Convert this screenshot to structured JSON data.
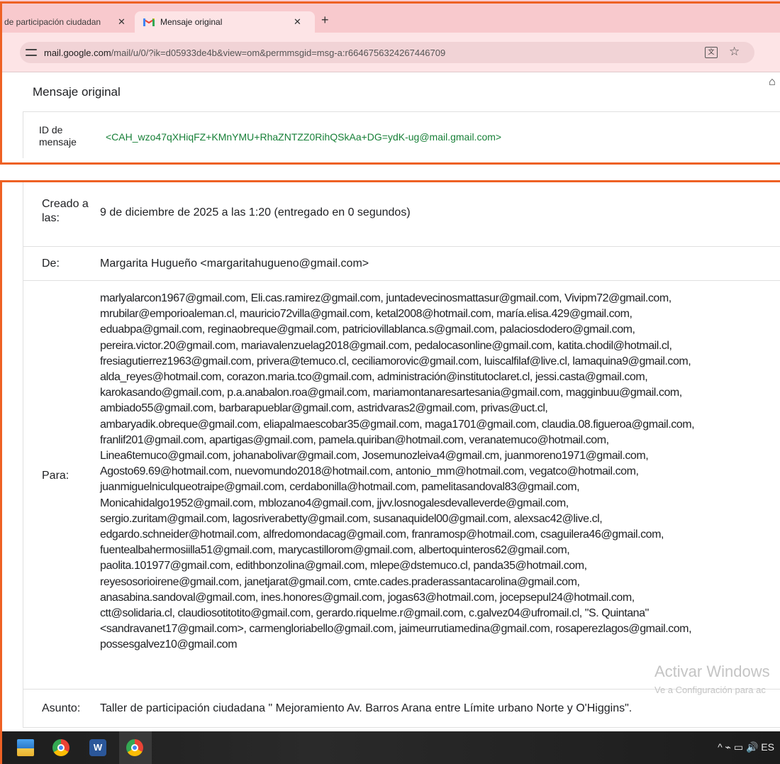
{
  "browser": {
    "tabs": [
      {
        "label": "de participación ciudadan",
        "active": false
      },
      {
        "label": "Mensaje original",
        "active": true
      }
    ],
    "new_tab_label": "+",
    "close_glyph": "✕",
    "url_host": "mail.google.com",
    "url_path": "/mail/u/0/?ik=d05933de4b&view=om&permmsgid=msg-a:r6646756324267446709",
    "translate_glyph": "文",
    "star_glyph": "☆",
    "extension_glyph": "⌂"
  },
  "page": {
    "title": "Mensaje original",
    "message_id_label": "ID de mensaje",
    "message_id_value": "<CAH_wzo47qXHiqFZ+KMnYMU+RhaZNTZZ0RihQSkAa+DG=ydK-ug@mail.gmail.com>"
  },
  "headers": {
    "created_label": "Creado a las:",
    "created_value": "9 de diciembre de 2025 a las 1:20 (entregado en 0 segundos)",
    "from_label": "De:",
    "from_value": "Margarita Hugueño <margaritahugueno@gmail.com>",
    "to_label": "Para:",
    "to_lines": [
      "marlyalarcon1967@gmail.com, Eli.cas.ramirez@gmail.com, juntadevecinosmattasur@gmail.com, Vivipm72@gmail.com,",
      "mrubilar@emporioaleman.cl, mauricio72villa@gmail.com, ketal2008@hotmail.com, maría.elisa.429@gmail.com,",
      "eduabpa@gmail.com, reginaobreque@gmail.com, patriciovillablanca.s@gmail.com, palaciosdodero@gmail.com,",
      "pereira.victor.20@gmail.com, mariavalenzuelag2018@gmail.com, pedalocasonline@gmail.com, katita.chodil@hotmail.cl,",
      "fresiagutierrez1963@gmail.com, privera@temuco.cl, ceciliamorovic@gmail.com, luiscalfilaf@live.cl, lamaquina9@gmail.com,",
      "alda_reyes@hotmail.com, corazon.maria.tco@gmail.com, administración@institutoclaret.cl, jessi.casta@gmail.com,",
      "karokasando@gmail.com, p.a.anabalon.roa@gmail.com, mariamontanaresartesania@gmail.com, magginbuu@gmail.com,",
      "ambiado55@gmail.com, barbarapueblar@gmail.com, astridvaras2@gmail.com, privas@uct.cl,",
      "ambaryadik.obreque@gmail.com, eliapalmaescobar35@gmail.com, maga1701@gmail.com, claudia.08.figueroa@gmail.com,",
      "franlif201@gmail.com, apartigas@gmail.com, pamela.quiriban@hotmail.com, veranatemuco@hotmail.com,",
      "Linea6temuco@gmail.com, johanabolivar@gmail.com, Josemunozleiva4@gmail.cm, juanmoreno1971@gmail.com,",
      "Agosto69.69@hotmail.com, nuevomundo2018@hotmail.com, antonio_mm@hotmail.com, vegatco@hotmail.com,",
      "juanmiguelniculqueotraipe@gmail.com, cerdabonilla@hotmail.com, pamelitasandoval83@gmail.com,",
      "Monicahidalgo1952@gmail.com, mblozano4@gmail.com, jjvv.losnogalesdevalleverde@gmail.com,",
      "sergio.zuritam@gmail.com, lagosriverabetty@gmail.com, susanaquidel00@gmail.com, alexsac42@live.cl,",
      "edgardo.schneider@hotmail.com, alfredomondacag@gmail.com, franramosp@hotmail.com, csaguilera46@gmail.com,",
      "fuentealbahermosiilla51@gmail.com, marycastillorom@gmail.com, albertoquinteros62@gmail.com,",
      "paolita.101977@gmail.com, edithbonzolina@gmail.com, mlepe@dstemuco.cl, panda35@hotmail.com,",
      "reyesosorioirene@gmail.com, janetjarat@gmail.com, cmte.cades.praderassantacarolina@gmail.com,",
      "anasabina.sandoval@gmail.com, ines.honores@gmail.com, jogas63@hotmail.com, jocepsepul24@hotmail.com,",
      "ctt@solidaria.cl, claudiosotitotito@gmail.com, gerardo.riquelme.r@gmail.com, c.galvez04@ufromail.cl, \"S. Quintana\"",
      "<sandravanet17@gmail.com>, carmengloriabello@gmail.com, jaimeurrutiamedina@gmail.com, rosaperezlagos@gmail.com,",
      "possesgalvez10@gmail.com"
    ],
    "subject_label": "Asunto:",
    "subject_value": "Taller de participación ciudadana \" Mejoramiento Av. Barros Arana entre Límite urbano Norte y O'Higgins\"."
  },
  "watermark": {
    "line1": "Activar Windows",
    "line2": "Ve a Configuración para ac"
  },
  "taskbar": {
    "word_letter": "W",
    "tray_text": "^  ⌁  ▭  🔊  ES"
  },
  "colors": {
    "highlight_frame": "#ee6124",
    "message_id": "#188038",
    "tab_strip": "#f8c9cd"
  }
}
